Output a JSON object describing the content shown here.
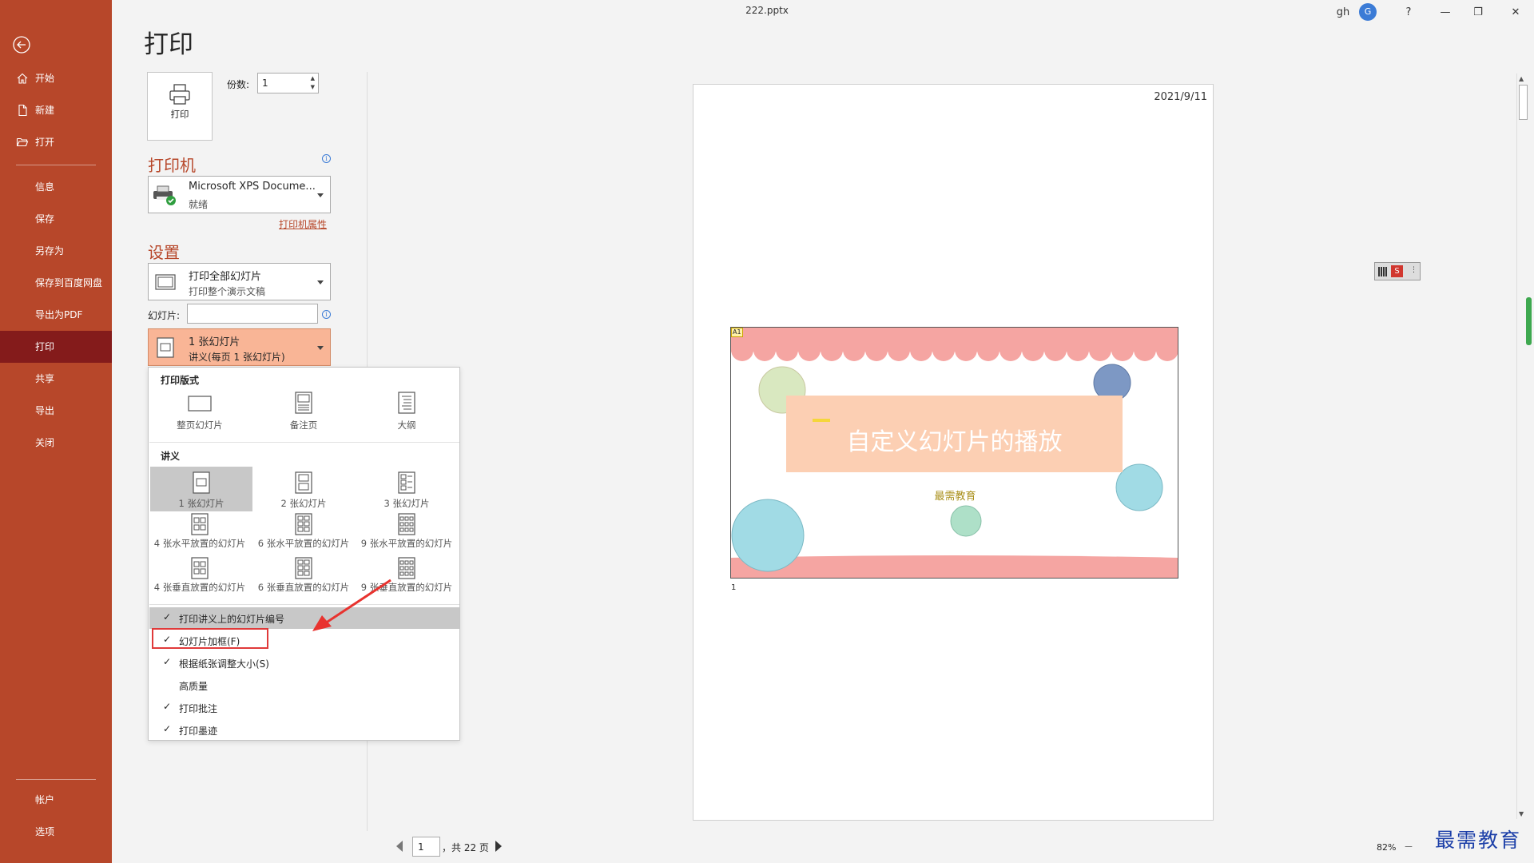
{
  "window": {
    "title": "222.pptx",
    "user_initials": "gh",
    "avatar_letter": "G",
    "help": "?",
    "minimize": "—",
    "restore": "❐",
    "close": "✕"
  },
  "sidebar": {
    "items": [
      {
        "label": "开始",
        "icon": "home-icon"
      },
      {
        "label": "新建",
        "icon": "new-file-icon"
      },
      {
        "label": "打开",
        "icon": "open-folder-icon"
      }
    ],
    "sub_items": [
      "信息",
      "保存",
      "另存为",
      "保存到百度网盘",
      "导出为PDF",
      "打印",
      "共享",
      "导出",
      "关闭"
    ],
    "active": "打印",
    "bottom_items": [
      "帐户",
      "选项"
    ]
  },
  "print": {
    "page_title": "打印",
    "print_button_label": "打印",
    "copies_label": "份数:",
    "copies_value": "1",
    "printer_heading": "打印机",
    "printer_name": "Microsoft XPS Docume...",
    "printer_status": "就绪",
    "printer_properties": "打印机属性",
    "settings_heading": "设置",
    "range_main": "打印全部幻灯片",
    "range_sub": "打印整个演示文稿",
    "slides_label": "幻灯片:",
    "slides_value": "",
    "layout_main": "1 张幻灯片",
    "layout_sub": "讲义(每页 1 张幻灯片)"
  },
  "flyout": {
    "layout_heading": "打印版式",
    "layouts": [
      "整页幻灯片",
      "备注页",
      "大纲"
    ],
    "handouts_heading": "讲义",
    "handouts": [
      "1 张幻灯片",
      "2 张幻灯片",
      "3 张幻灯片",
      "4 张水平放置的幻灯片",
      "6 张水平放置的幻灯片",
      "9 张水平放置的幻灯片",
      "4 张垂直放置的幻灯片",
      "6 张垂直放置的幻灯片",
      "9 张垂直放置的幻灯片"
    ],
    "options": [
      {
        "label": "打印讲义上的幻灯片编号",
        "checked": true
      },
      {
        "label": "幻灯片加框(F)",
        "checked": true
      },
      {
        "label": "根据纸张调整大小(S)",
        "checked": true
      },
      {
        "label": "高质量",
        "checked": false
      },
      {
        "label": "打印批注",
        "checked": true
      },
      {
        "label": "打印墨迹",
        "checked": true
      }
    ],
    "check_glyph": "✓"
  },
  "preview": {
    "date": "2021/9/11",
    "slide_title": "自定义幻灯片的播放",
    "slide_subtitle": "最需教育",
    "slide_tag": "A1",
    "slide_number": "1",
    "page_current": "1",
    "page_total_text": "，共 22 页",
    "zoom": "82%",
    "zoom_minus": "－"
  },
  "watermark": "最需教育",
  "colors": {
    "accent": "#b7472a",
    "nav_active": "#841b1b",
    "highlight_box": "#e03a3a",
    "scallop": "#f5a5a2",
    "title_box": "#fccfb3"
  }
}
